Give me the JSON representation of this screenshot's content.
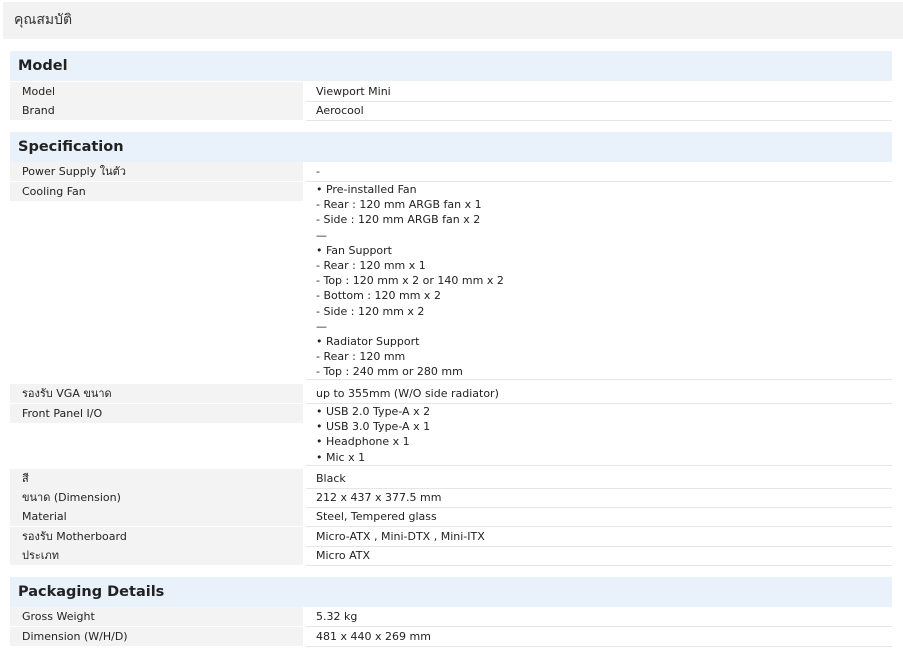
{
  "page_title": "คุณสมบัติ",
  "sections": {
    "model": {
      "title": "Model",
      "rows": [
        {
          "label": "Model",
          "value": "Viewport Mini"
        },
        {
          "label": "Brand",
          "value": "Aerocool"
        }
      ]
    },
    "specification": {
      "title": "Specification",
      "power_supply": {
        "label": "Power Supply ในตัว",
        "value": "-"
      },
      "cooling_fan": {
        "label": "Cooling Fan",
        "lines": [
          "• Pre-installed Fan",
          "- Rear : 120 mm ARGB fan x 1",
          "- Side : 120 mm ARGB fan x 2",
          "—",
          "• Fan Support",
          "- Rear : 120 mm x 1",
          "- Top : 120 mm x 2 or 140 mm x 2",
          "- Bottom : 120 mm x 2",
          "- Side : 120 mm x 2",
          "—",
          "• Radiator Support",
          "- Rear : 120 mm",
          "- Top : 240 mm or 280 mm"
        ]
      },
      "vga": {
        "label": "รองรับ VGA ขนาด",
        "value": "up to 355mm (W/O side radiator)"
      },
      "front_panel": {
        "label": "Front Panel I/O",
        "lines": [
          "• USB 2.0 Type-A x 2",
          "• USB 3.0 Type-A x 1",
          "• Headphone x 1",
          "• Mic x 1"
        ]
      },
      "rows": [
        {
          "label": "สี",
          "value": "Black"
        },
        {
          "label": "ขนาด (Dimension)",
          "value": "212 x 437 x 377.5 mm"
        },
        {
          "label": "Material",
          "value": "Steel, Tempered glass"
        },
        {
          "label": "รองรับ Motherboard",
          "value": "Micro-ATX , Mini-DTX , Mini-ITX"
        },
        {
          "label": "ประเภท",
          "value": "Micro ATX"
        }
      ]
    },
    "packaging": {
      "title": "Packaging Details",
      "rows": [
        {
          "label": "Gross Weight",
          "value": "5.32 kg"
        },
        {
          "label": "Dimension (W/H/D)",
          "value": "481 x 440 x 269 mm"
        }
      ]
    }
  }
}
